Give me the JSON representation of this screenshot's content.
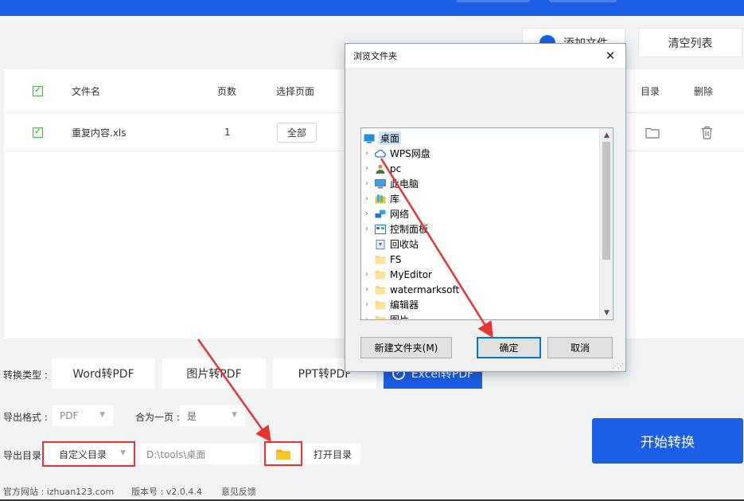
{
  "toolbar": {
    "add_file_label": "添加文件",
    "clear_list_label": "清空列表"
  },
  "table": {
    "headers": {
      "filename": "文件名",
      "pages": "页数",
      "select_pages": "选择页面",
      "toc": "目录",
      "delete": "删除"
    },
    "rows": [
      {
        "filename": "重复内容.xls",
        "pages": "1",
        "range": "全部"
      }
    ]
  },
  "conversion": {
    "type_label": "转换类型 :",
    "options": [
      "Word转PDF",
      "图片转PDF",
      "PPT转PDF",
      "Excel转PDF"
    ],
    "selected": "Excel转PDF"
  },
  "export": {
    "format_label": "导出格式 :",
    "format_value": "PDF",
    "merge_label": "合为一页 :",
    "merge_value": "是",
    "dir_label": "导出目录 :",
    "dir_mode": "自定义目录",
    "path": "D:\\tools\\桌面",
    "open_dir_label": "打开目录"
  },
  "start_button": "开始转换",
  "footer": {
    "website": "官方网站 : izhuan123.com",
    "version": "版本号 : v2.0.4.4",
    "feedback": "意见反馈"
  },
  "dialog": {
    "title": "浏览文件夹",
    "tree": [
      {
        "label": "桌面",
        "icon": "desktop-icon",
        "expandable": false,
        "selected": true,
        "indent": 0
      },
      {
        "label": "WPS网盘",
        "icon": "cloud-icon",
        "expandable": true,
        "selected": false,
        "indent": 1
      },
      {
        "label": "pc",
        "icon": "user-icon",
        "expandable": true,
        "selected": false,
        "indent": 1
      },
      {
        "label": "此电脑",
        "icon": "computer-icon",
        "expandable": true,
        "selected": false,
        "indent": 1
      },
      {
        "label": "库",
        "icon": "library-icon",
        "expandable": true,
        "selected": false,
        "indent": 1
      },
      {
        "label": "网络",
        "icon": "network-icon",
        "expandable": true,
        "selected": false,
        "indent": 1
      },
      {
        "label": "控制面板",
        "icon": "control-panel-icon",
        "expandable": true,
        "selected": false,
        "indent": 1
      },
      {
        "label": "回收站",
        "icon": "recycle-bin-icon",
        "expandable": false,
        "selected": false,
        "indent": 1
      },
      {
        "label": "FS",
        "icon": "folder-icon",
        "expandable": false,
        "selected": false,
        "indent": 1
      },
      {
        "label": "MyEditor",
        "icon": "folder-icon",
        "expandable": true,
        "selected": false,
        "indent": 1
      },
      {
        "label": "watermarksoft",
        "icon": "folder-icon",
        "expandable": true,
        "selected": false,
        "indent": 1
      },
      {
        "label": "编辑器",
        "icon": "folder-icon",
        "expandable": true,
        "selected": false,
        "indent": 1
      },
      {
        "label": "图片",
        "icon": "folder-icon",
        "expandable": true,
        "selected": false,
        "indent": 1
      }
    ],
    "new_folder_label": "新建文件夹(M)",
    "ok_label": "确定",
    "cancel_label": "取消"
  },
  "colors": {
    "brand_blue": "#1a5fe6",
    "annotation_red": "#e8342e",
    "folder_yellow": "#f4b400"
  }
}
